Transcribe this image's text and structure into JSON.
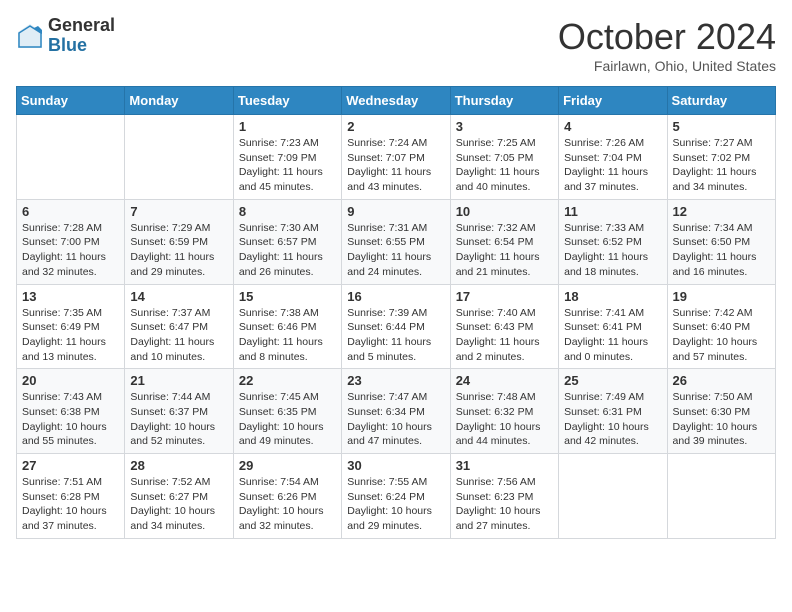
{
  "header": {
    "logo_general": "General",
    "logo_blue": "Blue",
    "month_title": "October 2024",
    "location": "Fairlawn, Ohio, United States"
  },
  "days_of_week": [
    "Sunday",
    "Monday",
    "Tuesday",
    "Wednesday",
    "Thursday",
    "Friday",
    "Saturday"
  ],
  "weeks": [
    [
      {
        "day": "",
        "content": ""
      },
      {
        "day": "",
        "content": ""
      },
      {
        "day": "1",
        "content": "Sunrise: 7:23 AM\nSunset: 7:09 PM\nDaylight: 11 hours and 45 minutes."
      },
      {
        "day": "2",
        "content": "Sunrise: 7:24 AM\nSunset: 7:07 PM\nDaylight: 11 hours and 43 minutes."
      },
      {
        "day": "3",
        "content": "Sunrise: 7:25 AM\nSunset: 7:05 PM\nDaylight: 11 hours and 40 minutes."
      },
      {
        "day": "4",
        "content": "Sunrise: 7:26 AM\nSunset: 7:04 PM\nDaylight: 11 hours and 37 minutes."
      },
      {
        "day": "5",
        "content": "Sunrise: 7:27 AM\nSunset: 7:02 PM\nDaylight: 11 hours and 34 minutes."
      }
    ],
    [
      {
        "day": "6",
        "content": "Sunrise: 7:28 AM\nSunset: 7:00 PM\nDaylight: 11 hours and 32 minutes."
      },
      {
        "day": "7",
        "content": "Sunrise: 7:29 AM\nSunset: 6:59 PM\nDaylight: 11 hours and 29 minutes."
      },
      {
        "day": "8",
        "content": "Sunrise: 7:30 AM\nSunset: 6:57 PM\nDaylight: 11 hours and 26 minutes."
      },
      {
        "day": "9",
        "content": "Sunrise: 7:31 AM\nSunset: 6:55 PM\nDaylight: 11 hours and 24 minutes."
      },
      {
        "day": "10",
        "content": "Sunrise: 7:32 AM\nSunset: 6:54 PM\nDaylight: 11 hours and 21 minutes."
      },
      {
        "day": "11",
        "content": "Sunrise: 7:33 AM\nSunset: 6:52 PM\nDaylight: 11 hours and 18 minutes."
      },
      {
        "day": "12",
        "content": "Sunrise: 7:34 AM\nSunset: 6:50 PM\nDaylight: 11 hours and 16 minutes."
      }
    ],
    [
      {
        "day": "13",
        "content": "Sunrise: 7:35 AM\nSunset: 6:49 PM\nDaylight: 11 hours and 13 minutes."
      },
      {
        "day": "14",
        "content": "Sunrise: 7:37 AM\nSunset: 6:47 PM\nDaylight: 11 hours and 10 minutes."
      },
      {
        "day": "15",
        "content": "Sunrise: 7:38 AM\nSunset: 6:46 PM\nDaylight: 11 hours and 8 minutes."
      },
      {
        "day": "16",
        "content": "Sunrise: 7:39 AM\nSunset: 6:44 PM\nDaylight: 11 hours and 5 minutes."
      },
      {
        "day": "17",
        "content": "Sunrise: 7:40 AM\nSunset: 6:43 PM\nDaylight: 11 hours and 2 minutes."
      },
      {
        "day": "18",
        "content": "Sunrise: 7:41 AM\nSunset: 6:41 PM\nDaylight: 11 hours and 0 minutes."
      },
      {
        "day": "19",
        "content": "Sunrise: 7:42 AM\nSunset: 6:40 PM\nDaylight: 10 hours and 57 minutes."
      }
    ],
    [
      {
        "day": "20",
        "content": "Sunrise: 7:43 AM\nSunset: 6:38 PM\nDaylight: 10 hours and 55 minutes."
      },
      {
        "day": "21",
        "content": "Sunrise: 7:44 AM\nSunset: 6:37 PM\nDaylight: 10 hours and 52 minutes."
      },
      {
        "day": "22",
        "content": "Sunrise: 7:45 AM\nSunset: 6:35 PM\nDaylight: 10 hours and 49 minutes."
      },
      {
        "day": "23",
        "content": "Sunrise: 7:47 AM\nSunset: 6:34 PM\nDaylight: 10 hours and 47 minutes."
      },
      {
        "day": "24",
        "content": "Sunrise: 7:48 AM\nSunset: 6:32 PM\nDaylight: 10 hours and 44 minutes."
      },
      {
        "day": "25",
        "content": "Sunrise: 7:49 AM\nSunset: 6:31 PM\nDaylight: 10 hours and 42 minutes."
      },
      {
        "day": "26",
        "content": "Sunrise: 7:50 AM\nSunset: 6:30 PM\nDaylight: 10 hours and 39 minutes."
      }
    ],
    [
      {
        "day": "27",
        "content": "Sunrise: 7:51 AM\nSunset: 6:28 PM\nDaylight: 10 hours and 37 minutes."
      },
      {
        "day": "28",
        "content": "Sunrise: 7:52 AM\nSunset: 6:27 PM\nDaylight: 10 hours and 34 minutes."
      },
      {
        "day": "29",
        "content": "Sunrise: 7:54 AM\nSunset: 6:26 PM\nDaylight: 10 hours and 32 minutes."
      },
      {
        "day": "30",
        "content": "Sunrise: 7:55 AM\nSunset: 6:24 PM\nDaylight: 10 hours and 29 minutes."
      },
      {
        "day": "31",
        "content": "Sunrise: 7:56 AM\nSunset: 6:23 PM\nDaylight: 10 hours and 27 minutes."
      },
      {
        "day": "",
        "content": ""
      },
      {
        "day": "",
        "content": ""
      }
    ]
  ]
}
